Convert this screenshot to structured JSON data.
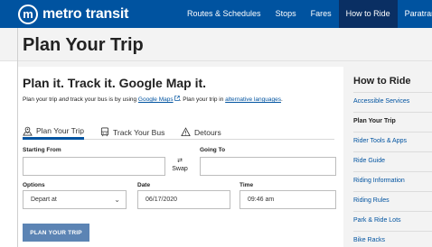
{
  "header": {
    "logo_letter": "m",
    "logo_text": "metro transit",
    "nav": [
      {
        "label": "Routes & Schedules",
        "active": false
      },
      {
        "label": "Stops",
        "active": false
      },
      {
        "label": "Fares",
        "active": false
      },
      {
        "label": "How to Ride",
        "active": true
      },
      {
        "label": "Paratrans",
        "active": false
      }
    ]
  },
  "page": {
    "title": "Plan Your Trip"
  },
  "main": {
    "headline": "Plan it. Track it. Google Map it.",
    "intro": {
      "part1": "Plan your trip ",
      "and": "and",
      "part2": " track your bus is by using ",
      "link1": "Google Maps",
      "part3": ". Plan your trip in ",
      "link2": "alternative languages",
      "part4": "."
    },
    "tabs": [
      {
        "label": "Plan Your Trip",
        "icon": "map-pin-icon",
        "active": true
      },
      {
        "label": "Track Your Bus",
        "icon": "bus-icon",
        "active": false
      },
      {
        "label": "Detours",
        "icon": "warning-icon",
        "active": false
      }
    ],
    "form": {
      "starting_from_label": "Starting From",
      "starting_from_value": "",
      "going_to_label": "Going To",
      "going_to_value": "",
      "swap_symbol": "⇄",
      "swap_label": "Swap",
      "options_label": "Options",
      "options_value": "Depart at",
      "date_label": "Date",
      "date_value": "06/17/2020",
      "time_label": "Time",
      "time_value": "09:46 am"
    },
    "plan_button": "PLAN YOUR TRIP"
  },
  "sidebar": {
    "title": "How to Ride",
    "items": [
      {
        "label": "Accessible Services",
        "active": false
      },
      {
        "label": "Plan Your Trip",
        "active": true
      },
      {
        "label": "Rider Tools & Apps",
        "active": false
      },
      {
        "label": "Ride Guide",
        "active": false
      },
      {
        "label": "Riding Information",
        "active": false
      },
      {
        "label": "Riding Rules",
        "active": false
      },
      {
        "label": "Park & Ride Lots",
        "active": false
      },
      {
        "label": "Bike Racks",
        "active": false
      }
    ]
  },
  "colors": {
    "brand": "#0053a0",
    "nav_active": "#0a2f63",
    "button": "#5c84b4"
  }
}
